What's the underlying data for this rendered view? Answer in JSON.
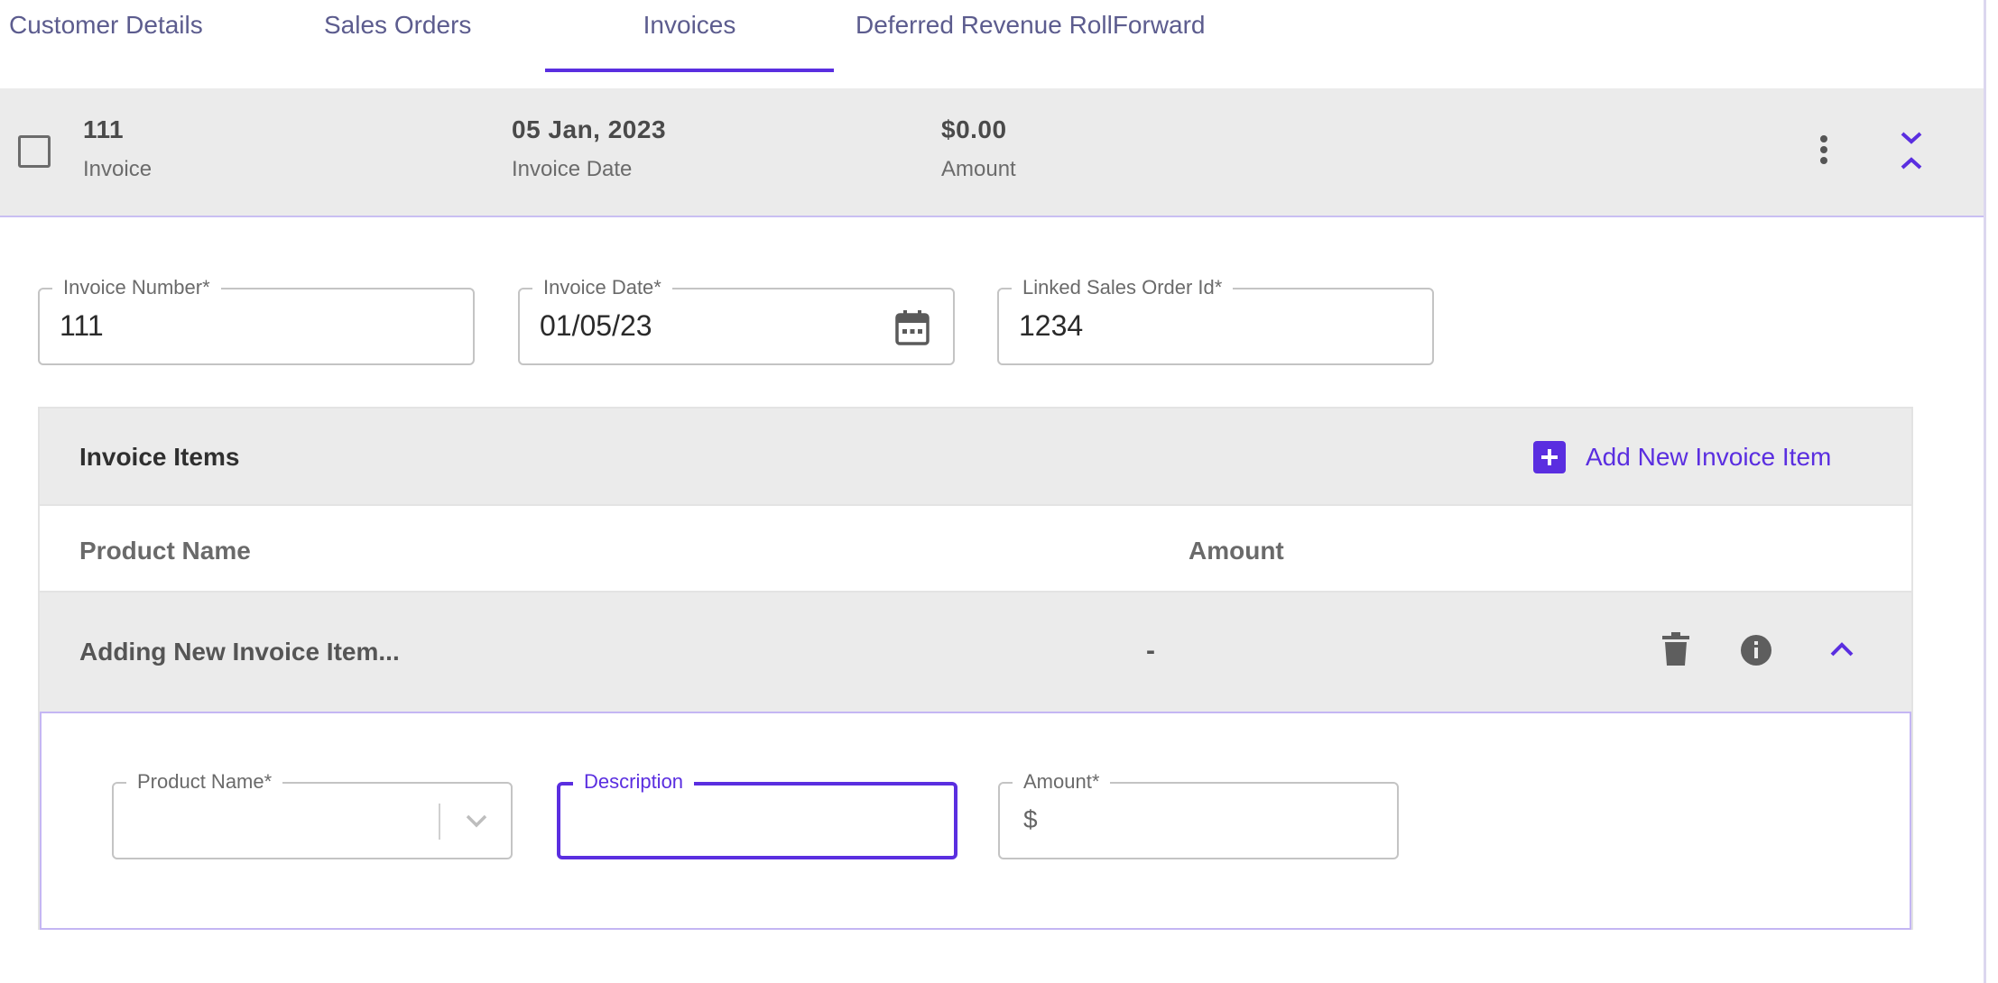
{
  "tabs": [
    {
      "label": "Customer Details"
    },
    {
      "label": "Sales Orders"
    },
    {
      "label": "Invoices",
      "active": true
    },
    {
      "label": "Deferred Revenue RollForward"
    }
  ],
  "summary": {
    "invoice_value": "111",
    "invoice_label": "Invoice",
    "date_value": "05 Jan, 2023",
    "date_label": "Invoice Date",
    "amount_value": "$0.00",
    "amount_label": "Amount"
  },
  "form": {
    "invoice_number": {
      "label": "Invoice Number",
      "required": "*",
      "value": "111"
    },
    "invoice_date": {
      "label": "Invoice Date",
      "required": "*",
      "value": "01/05/23"
    },
    "linked_sales_order": {
      "label": "Linked Sales Order Id",
      "required": "*",
      "value": "1234"
    }
  },
  "items": {
    "title": "Invoice Items",
    "add_label": "Add New Invoice Item",
    "columns": [
      "Product Name",
      "Amount"
    ],
    "row": {
      "name": "Adding New Invoice Item...",
      "amount": "-"
    },
    "item_form": {
      "product_name": {
        "label": "Product Name",
        "required": "*",
        "value": ""
      },
      "description": {
        "label": "Description",
        "value": ""
      },
      "amount": {
        "label": "Amount",
        "required": "*",
        "prefix": "$",
        "value": ""
      }
    }
  },
  "colors": {
    "accent": "#5a2ee0",
    "row_bg": "#ebebeb",
    "tab_text": "#5c5c8e"
  },
  "icons": [
    "checkbox-icon",
    "more-vert-icon",
    "collapse-all-icon",
    "calendar-icon",
    "add-box-icon",
    "trash-icon",
    "info-icon",
    "chevron-up-icon",
    "chevron-down-icon"
  ]
}
